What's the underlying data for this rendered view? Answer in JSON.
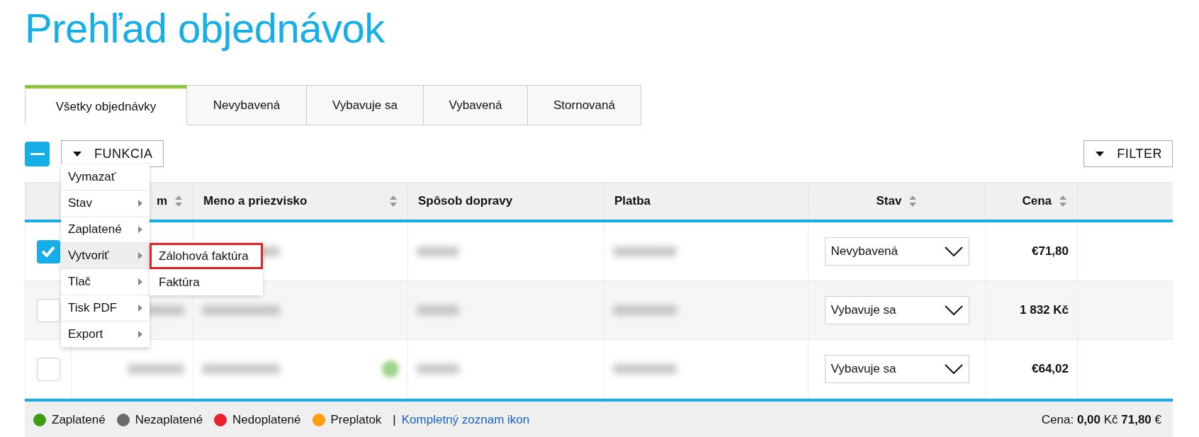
{
  "page_title": "Prehľad objednávok",
  "tabs": [
    {
      "label": "Všetky objednávky",
      "selected": true
    },
    {
      "label": "Nevybavená",
      "selected": false
    },
    {
      "label": "Vybavuje sa",
      "selected": false
    },
    {
      "label": "Vybavená",
      "selected": false
    },
    {
      "label": "Stornovaná",
      "selected": false
    }
  ],
  "toolbar": {
    "select_all": {
      "indeterminate": true
    },
    "function_button": {
      "label": "FUNKCIA"
    },
    "filter_button": {
      "label": "FILTER"
    }
  },
  "function_menu": {
    "items": [
      {
        "label": "Vymazať",
        "has_submenu": false,
        "selected": false
      },
      {
        "label": "Stav",
        "has_submenu": true,
        "selected": false
      },
      {
        "label": "Zaplatené",
        "has_submenu": true,
        "selected": false
      },
      {
        "label": "Vytvoriť",
        "has_submenu": true,
        "selected": true
      },
      {
        "label": "Tlač",
        "has_submenu": true,
        "selected": false
      },
      {
        "label": "Tisk PDF",
        "has_submenu": true,
        "selected": false
      },
      {
        "label": "Export",
        "has_submenu": true,
        "selected": false
      }
    ],
    "submenu": [
      {
        "label": "Zálohová faktúra",
        "highlighted": true
      },
      {
        "label": "Faktúra",
        "highlighted": false
      }
    ]
  },
  "table": {
    "columns": [
      {
        "kind": "check",
        "sortable": false
      },
      {
        "kind": "text",
        "label": "m",
        "sortable": true
      },
      {
        "kind": "text",
        "label": "Meno a priezvisko",
        "sortable": true
      },
      {
        "kind": "text",
        "label": "Spôsob dopravy",
        "sortable": false
      },
      {
        "kind": "text",
        "label": "Platba",
        "sortable": false
      },
      {
        "kind": "status",
        "label": "Stav",
        "sortable": true
      },
      {
        "kind": "price",
        "label": "Cena",
        "sortable": true
      },
      {
        "kind": "empty",
        "sortable": false
      }
    ],
    "rows": [
      {
        "checked": true,
        "status": "Nevybavená",
        "price": "€71,80",
        "paid_icon": false
      },
      {
        "checked": false,
        "status": "Vybavuje sa",
        "price": "1 832 Kč",
        "paid_icon": false
      },
      {
        "checked": false,
        "status": "Vybavuje sa",
        "price": "€64,02",
        "paid_icon": true
      }
    ]
  },
  "footer": {
    "legend": [
      {
        "label": "Zaplatené",
        "color": "#3a9c0e"
      },
      {
        "label": "Nezaplatené",
        "color": "#6b6b6b"
      },
      {
        "label": "Nedoplatené",
        "color": "#e8212a"
      },
      {
        "label": "Preplatok",
        "color": "#ff9e0b"
      }
    ],
    "separator": "|",
    "link": "Kompletný zoznam ikon",
    "total": "Cena: **0,00** Kč **71,80** €"
  }
}
